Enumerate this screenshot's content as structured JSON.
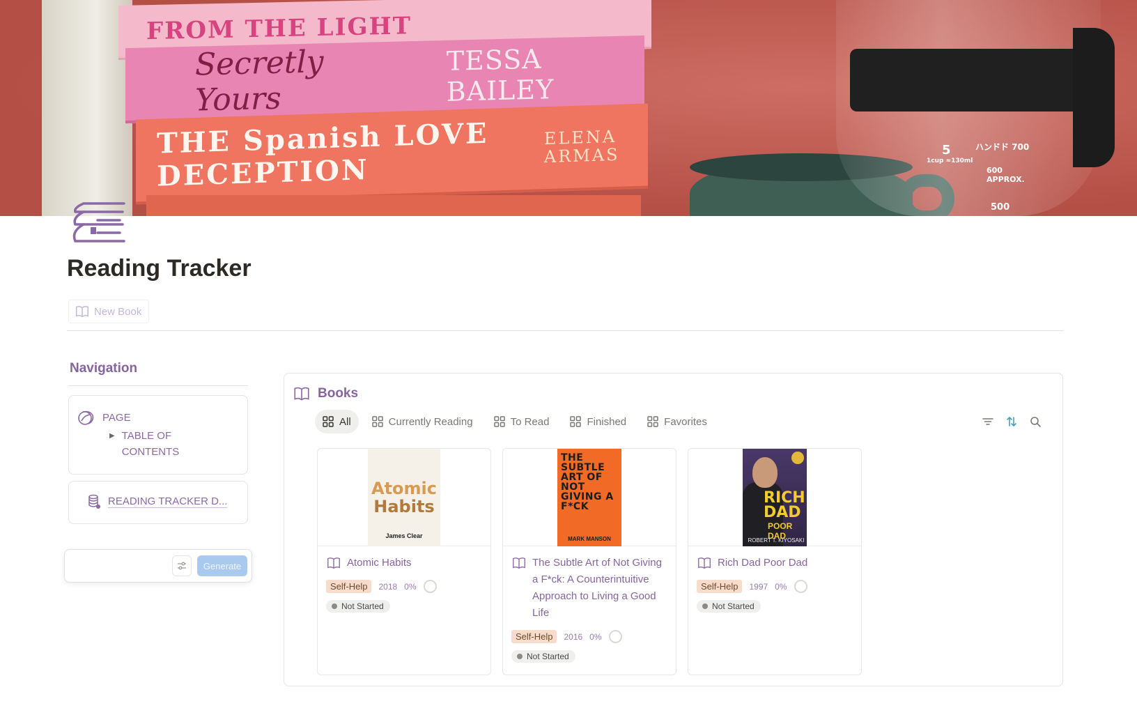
{
  "cover": {
    "book1_text": "FROM THE LIGHT",
    "book2_title": "Secretly Yours",
    "book2_author": "TESSA BAILEY",
    "book3_title": "THE Spanish LOVE DECEPTION",
    "book3_author": "ELENA ARMAS",
    "carafe_marks": [
      "5",
      "1cup ≈130ml",
      "ハンドド 700",
      "600 APPROX.",
      "500"
    ]
  },
  "page": {
    "title": "Reading Tracker",
    "new_book_label": "New Book"
  },
  "navigation": {
    "heading": "Navigation",
    "page_label": "PAGE",
    "toc_label": "TABLE OF CONTENTS",
    "db_link_label": "READING TRACKER D..."
  },
  "ai_box": {
    "generate_label": "Generate"
  },
  "database": {
    "title": "Books",
    "tabs": [
      {
        "label": "All",
        "active": true
      },
      {
        "label": "Currently Reading",
        "active": false
      },
      {
        "label": "To Read",
        "active": false
      },
      {
        "label": "Finished",
        "active": false
      },
      {
        "label": "Favorites",
        "active": false
      }
    ],
    "cards": [
      {
        "title": "Atomic Habits",
        "cover_title_1": "Atomic",
        "cover_title_2": "Habits",
        "cover_author": "James Clear",
        "genre": "Self-Help",
        "year": "2018",
        "progress": "0%",
        "status": "Not Started"
      },
      {
        "title": "The Subtle Art of Not Giving a F*ck: A Counterintuitive Approach to Living a Good Life",
        "cover_title": "THE SUBTLE ART OF NOT GIVING A F*CK",
        "cover_author": "MARK MANSON",
        "genre": "Self-Help",
        "year": "2016",
        "progress": "0%",
        "status": "Not Started"
      },
      {
        "title": "Rich Dad Poor Dad",
        "cover_title": "RICH DAD",
        "cover_subtitle": "POOR DAD",
        "cover_author": "ROBERT T. KIYOSAKI",
        "genre": "Self-Help",
        "year": "1997",
        "progress": "0%",
        "status": "Not Started"
      }
    ]
  },
  "colors": {
    "accent_purple": "#86659f",
    "tag_bg": "#f8dccb",
    "generate_bg": "#a9c9ee",
    "sort_icon": "#4a9bb5"
  },
  "icons": [
    "bookshelf-icon",
    "book-open-icon",
    "page-icon",
    "database-icon",
    "sliders-icon",
    "grid-icon",
    "filter-icon",
    "sort-icon",
    "search-icon"
  ]
}
